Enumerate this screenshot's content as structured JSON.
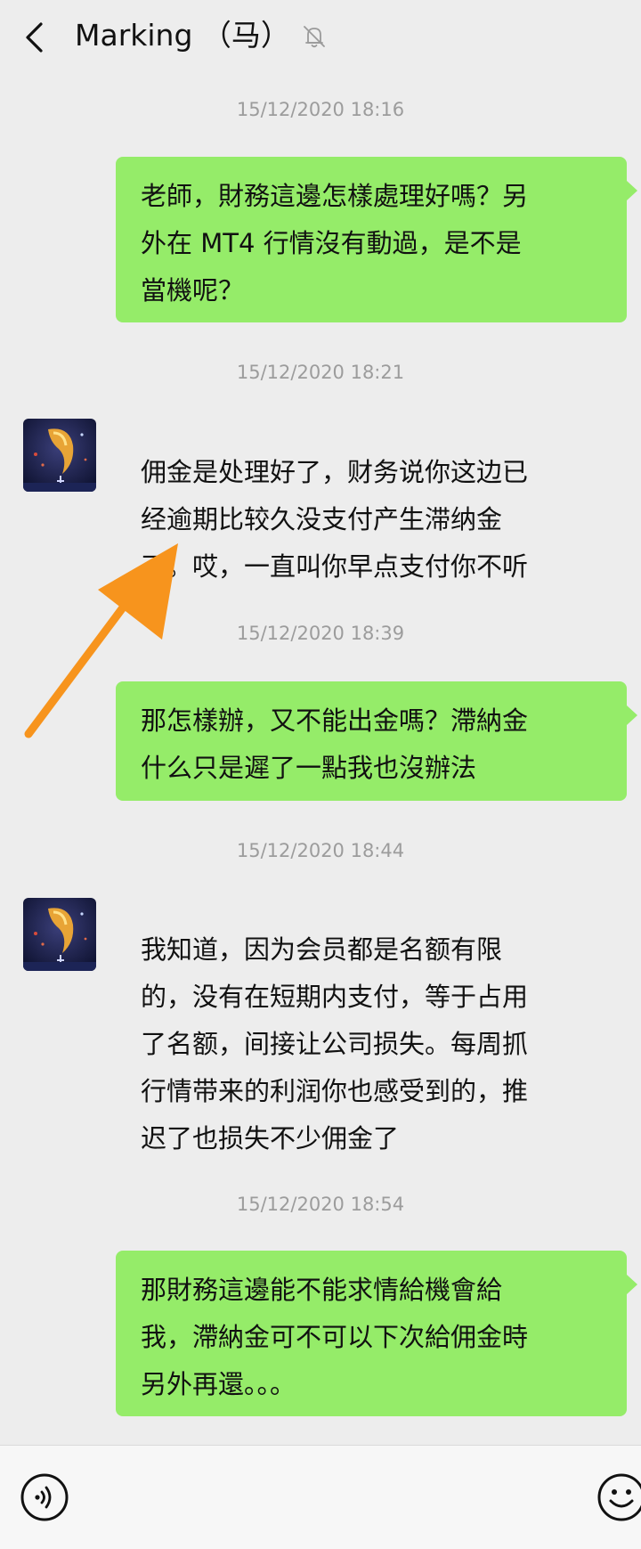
{
  "header": {
    "title": "Marking （马）"
  },
  "messages": [
    {
      "timestamp": "15/12/2020 18:16",
      "sender": "me",
      "text": "老師，財務這邊怎樣處理好嗎？另\n外在 MT4 行情沒有動過，是不是\n當機呢？"
    },
    {
      "timestamp": "15/12/2020 18:21",
      "sender": "them",
      "text": "佣金是处理好了，财务说你这边已\n经逾期比较久没支付产生滞纳金\n了。哎，一直叫你早点支付你不听"
    },
    {
      "timestamp": "15/12/2020 18:39",
      "sender": "me",
      "text": "那怎樣辦，又不能出金嗎？滯納金\n什么只是遲了一點我也沒辦法"
    },
    {
      "timestamp": "15/12/2020 18:44",
      "sender": "them",
      "text": "我知道，因为会员都是名额有限\n的，没有在短期内支付，等于占用\n了名额，间接让公司损失。每周抓\n行情带来的利润你也感受到的，推\n迟了也损失不少佣金了"
    },
    {
      "timestamp": "15/12/2020 18:54",
      "sender": "me",
      "text": "那財務這邊能不能求情給機會給\n我，滯納金可不可以下次給佣金時\n另外再還。。。"
    }
  ],
  "icons": {
    "back": "back-arrow-icon",
    "mute": "mute-bell-icon",
    "voice": "voice-input-icon",
    "emoji": "emoji-icon"
  },
  "colors": {
    "background": "#ededed",
    "my_bubble": "#95ec69",
    "timestamp": "#9c9c9c",
    "annotation_arrow": "#f7941d"
  }
}
